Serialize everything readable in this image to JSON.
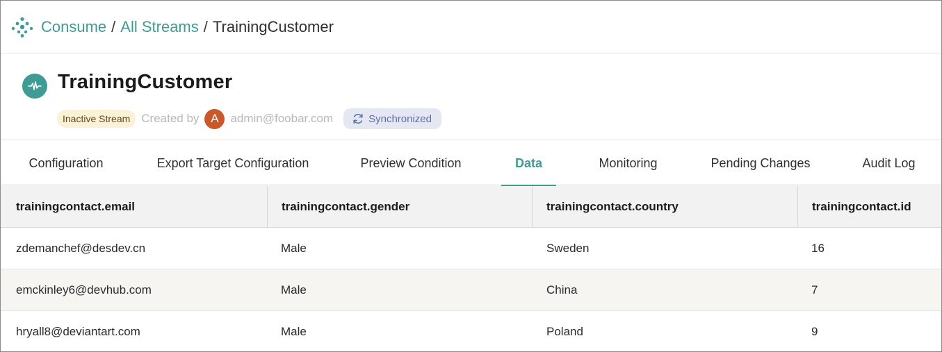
{
  "breadcrumb": {
    "items": [
      "Consume",
      "All Streams"
    ],
    "separator": "/",
    "current": "TrainingCustomer"
  },
  "stream": {
    "title": "TrainingCustomer",
    "status_badge": "Inactive Stream",
    "created_by_label": "Created by",
    "avatar_initial": "A",
    "creator": "admin@foobar.com",
    "sync_label": "Synchronized"
  },
  "tabs": [
    {
      "label": "Configuration",
      "active": false
    },
    {
      "label": "Export Target Configuration",
      "active": false
    },
    {
      "label": "Preview Condition",
      "active": false
    },
    {
      "label": "Data",
      "active": true
    },
    {
      "label": "Monitoring",
      "active": false
    },
    {
      "label": "Pending Changes",
      "active": false
    },
    {
      "label": "Audit Log",
      "active": false
    }
  ],
  "table": {
    "columns": [
      "trainingcontact.email",
      "trainingcontact.gender",
      "trainingcontact.country",
      "trainingcontact.id"
    ],
    "rows": [
      [
        "zdemanchef@desdev.cn",
        "Male",
        "Sweden",
        "16"
      ],
      [
        "emckinley6@devhub.com",
        "Male",
        "China",
        "7"
      ],
      [
        "hryall8@deviantart.com",
        "Male",
        "Poland",
        "9"
      ]
    ]
  },
  "colors": {
    "accent": "#3f9b95",
    "inactive_badge_bg": "#fbf1d6",
    "sync_badge_bg": "#e5e8f2",
    "sync_badge_text": "#5d6fa8",
    "avatar_bg": "#c9582a"
  },
  "icons": {
    "logo": "dots-cluster-logo-icon",
    "stream": "waveform-icon",
    "sync": "refresh-icon"
  }
}
